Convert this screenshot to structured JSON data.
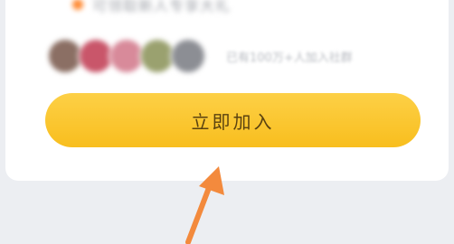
{
  "card": {
    "bullet_color": "#ff8a33",
    "blurred_line_text": "可领取新人专享大礼"
  },
  "members": {
    "avatar_colors": [
      "#8b6f64",
      "#c9566a",
      "#d88a9a",
      "#9aa16f",
      "#8c8e94"
    ],
    "joined_text": "已有100万+人加入社群"
  },
  "cta": {
    "label": "立即加入",
    "color": "#fbc72d"
  },
  "annotation": {
    "arrow_icon": "arrow-up-icon",
    "color": "#f38a3d"
  }
}
